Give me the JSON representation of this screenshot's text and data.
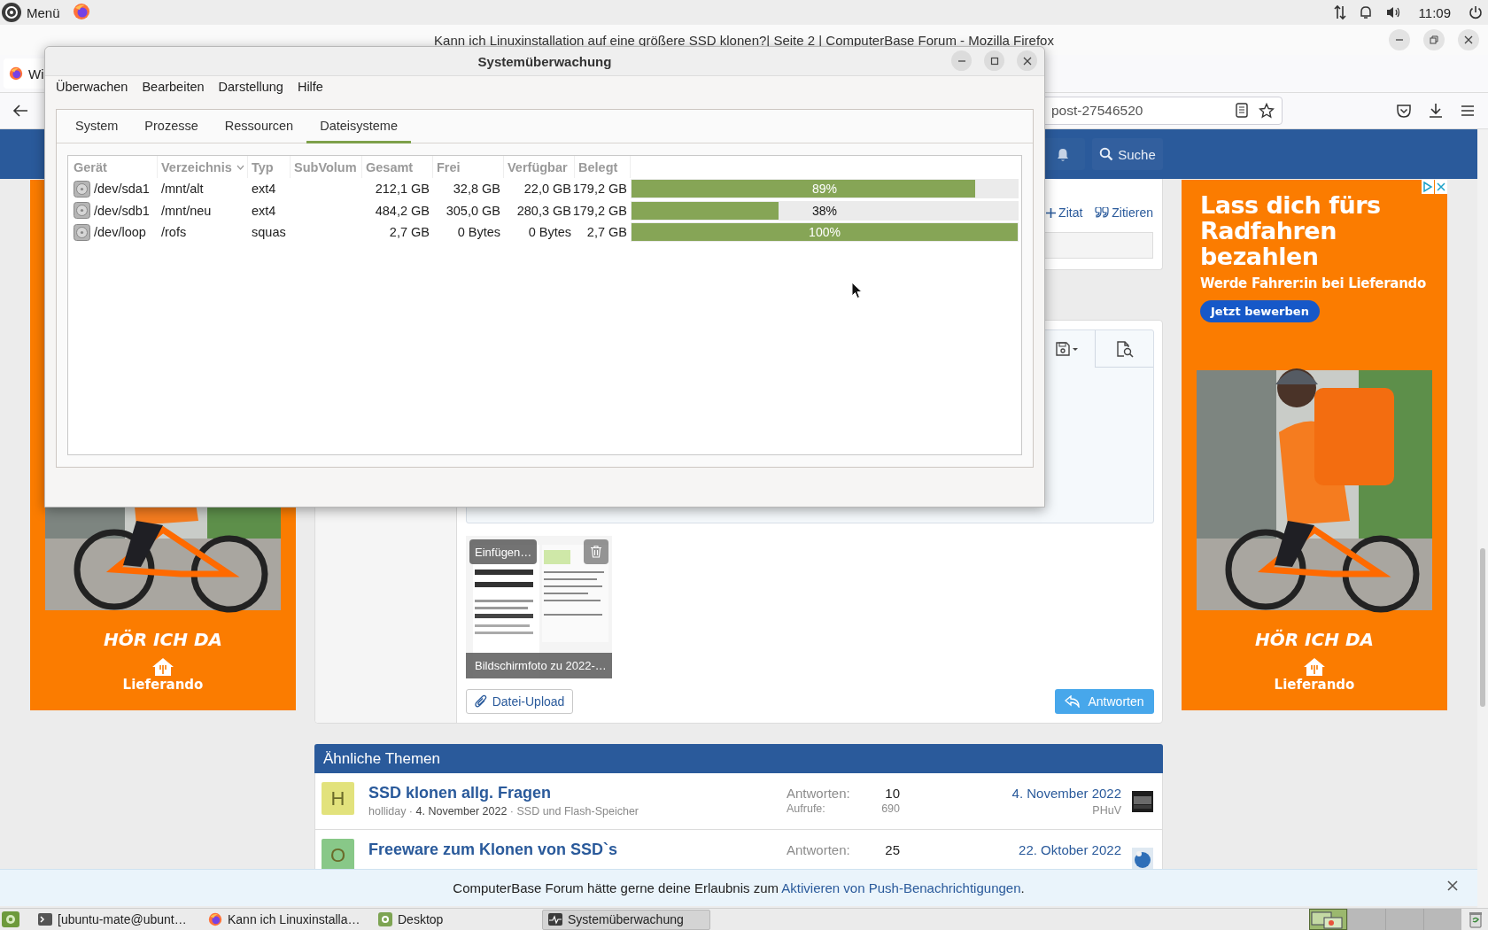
{
  "top_panel": {
    "menu_label": "Menü",
    "clock": "11:09"
  },
  "firefox": {
    "title": "Kann ich Linuxinstallation auf eine größere SSD klonen?| Seite 2 | ComputerBase Forum - Mozilla Firefox",
    "tab": {
      "label": "Wi"
    },
    "url": "post-27546520"
  },
  "forum": {
    "search_label": "Suche",
    "post_actions": [
      "Zitat",
      "Zitieren"
    ],
    "attachment": {
      "insert_label": "Einfügen…",
      "caption": "Bildschirmfoto zu 2022-…"
    },
    "upload_button": "Datei-Upload",
    "reply_button": "Antworten",
    "similar": {
      "title": "Ähnliche Themen",
      "threads": [
        {
          "initial": "H",
          "color": "#e2e27c",
          "title": "SSD klonen allg. Fragen",
          "meta": "holliday · **4. November 2022** · SSD und Flash-Speicher",
          "replies_label": "Antworten:",
          "replies": "10",
          "views_label": "Aufrufe:",
          "views": "690",
          "last_date": "4. November 2022",
          "last_user": "PHuV"
        },
        {
          "initial": "O",
          "color": "#88c888",
          "title": "Freeware zum Klonen von SSD`s",
          "replies_label": "Antworten:",
          "replies": "25",
          "last_date": "22. Oktober 2022"
        }
      ]
    },
    "notification": {
      "text": "ComputerBase Forum hätte gerne deine Erlaubnis zum ",
      "link": "Aktivieren von Push-Benachrichtigungen",
      "end": "."
    }
  },
  "ads": [
    {
      "slogan": "HÖR ICH DA",
      "brand": "Lieferando"
    },
    {
      "headline": "Lass dich fürs Radfahren bezahlen",
      "subline": "Werde Fahrer:in bei Lieferando",
      "button": "Jetzt bewerben",
      "slogan": "HÖR ICH DA",
      "brand": "Lieferando"
    }
  ],
  "monitor": {
    "title": "Systemüberwachung",
    "menu": [
      "Überwachen",
      "Bearbeiten",
      "Darstellung",
      "Hilfe"
    ],
    "tabs": [
      {
        "label": "System",
        "selected": false
      },
      {
        "label": "Prozesse",
        "selected": false
      },
      {
        "label": "Ressourcen",
        "selected": false
      },
      {
        "label": "Dateisysteme",
        "selected": true
      }
    ],
    "columns": [
      {
        "label": "Gerät",
        "sorted": false
      },
      {
        "label": "Verzeichnis",
        "sorted": true
      },
      {
        "label": "Typ",
        "sorted": false
      },
      {
        "label": "SubVolum",
        "sorted": false
      },
      {
        "label": "Gesamt",
        "sorted": false
      },
      {
        "label": "Frei",
        "sorted": false
      },
      {
        "label": "Verfügbar",
        "sorted": false
      },
      {
        "label": "Belegt",
        "sorted": false
      }
    ],
    "rows": [
      {
        "device": "/dev/sda1",
        "directory": "/mnt/alt",
        "type": "ext4",
        "total": "212,1 GB",
        "free": "32,8 GB",
        "available": "22,0 GB",
        "used": "179,2 GB",
        "level": 0.89,
        "percent": "89%"
      },
      {
        "device": "/dev/sdb1",
        "directory": "/mnt/neu",
        "type": "ext4",
        "total": "484,2 GB",
        "free": "305,0 GB",
        "available": "280,3 GB",
        "used": "179,2 GB",
        "level": 0.38,
        "percent": "38%"
      },
      {
        "device": "/dev/loop",
        "directory": "/rofs",
        "type": "squas",
        "total": "2,7 GB",
        "free": "0 Bytes",
        "available": "0 Bytes",
        "used": "2,7 GB",
        "level": 1.0,
        "percent": "100%"
      }
    ]
  },
  "taskbar": {
    "items": [
      {
        "label": "[ubuntu-mate@ubunt…",
        "kind": "terminal",
        "selected": false
      },
      {
        "label": "Kann ich Linuxinstalla…",
        "kind": "browser",
        "selected": false
      },
      {
        "label": "Desktop",
        "kind": "desktop",
        "selected": false
      },
      {
        "label": "Systemüberwachung",
        "kind": "monitor",
        "selected": true
      }
    ],
    "workspaces": [
      {
        "selected": true
      },
      {
        "selected": false
      },
      {
        "selected": false
      },
      {
        "selected": false
      }
    ]
  }
}
